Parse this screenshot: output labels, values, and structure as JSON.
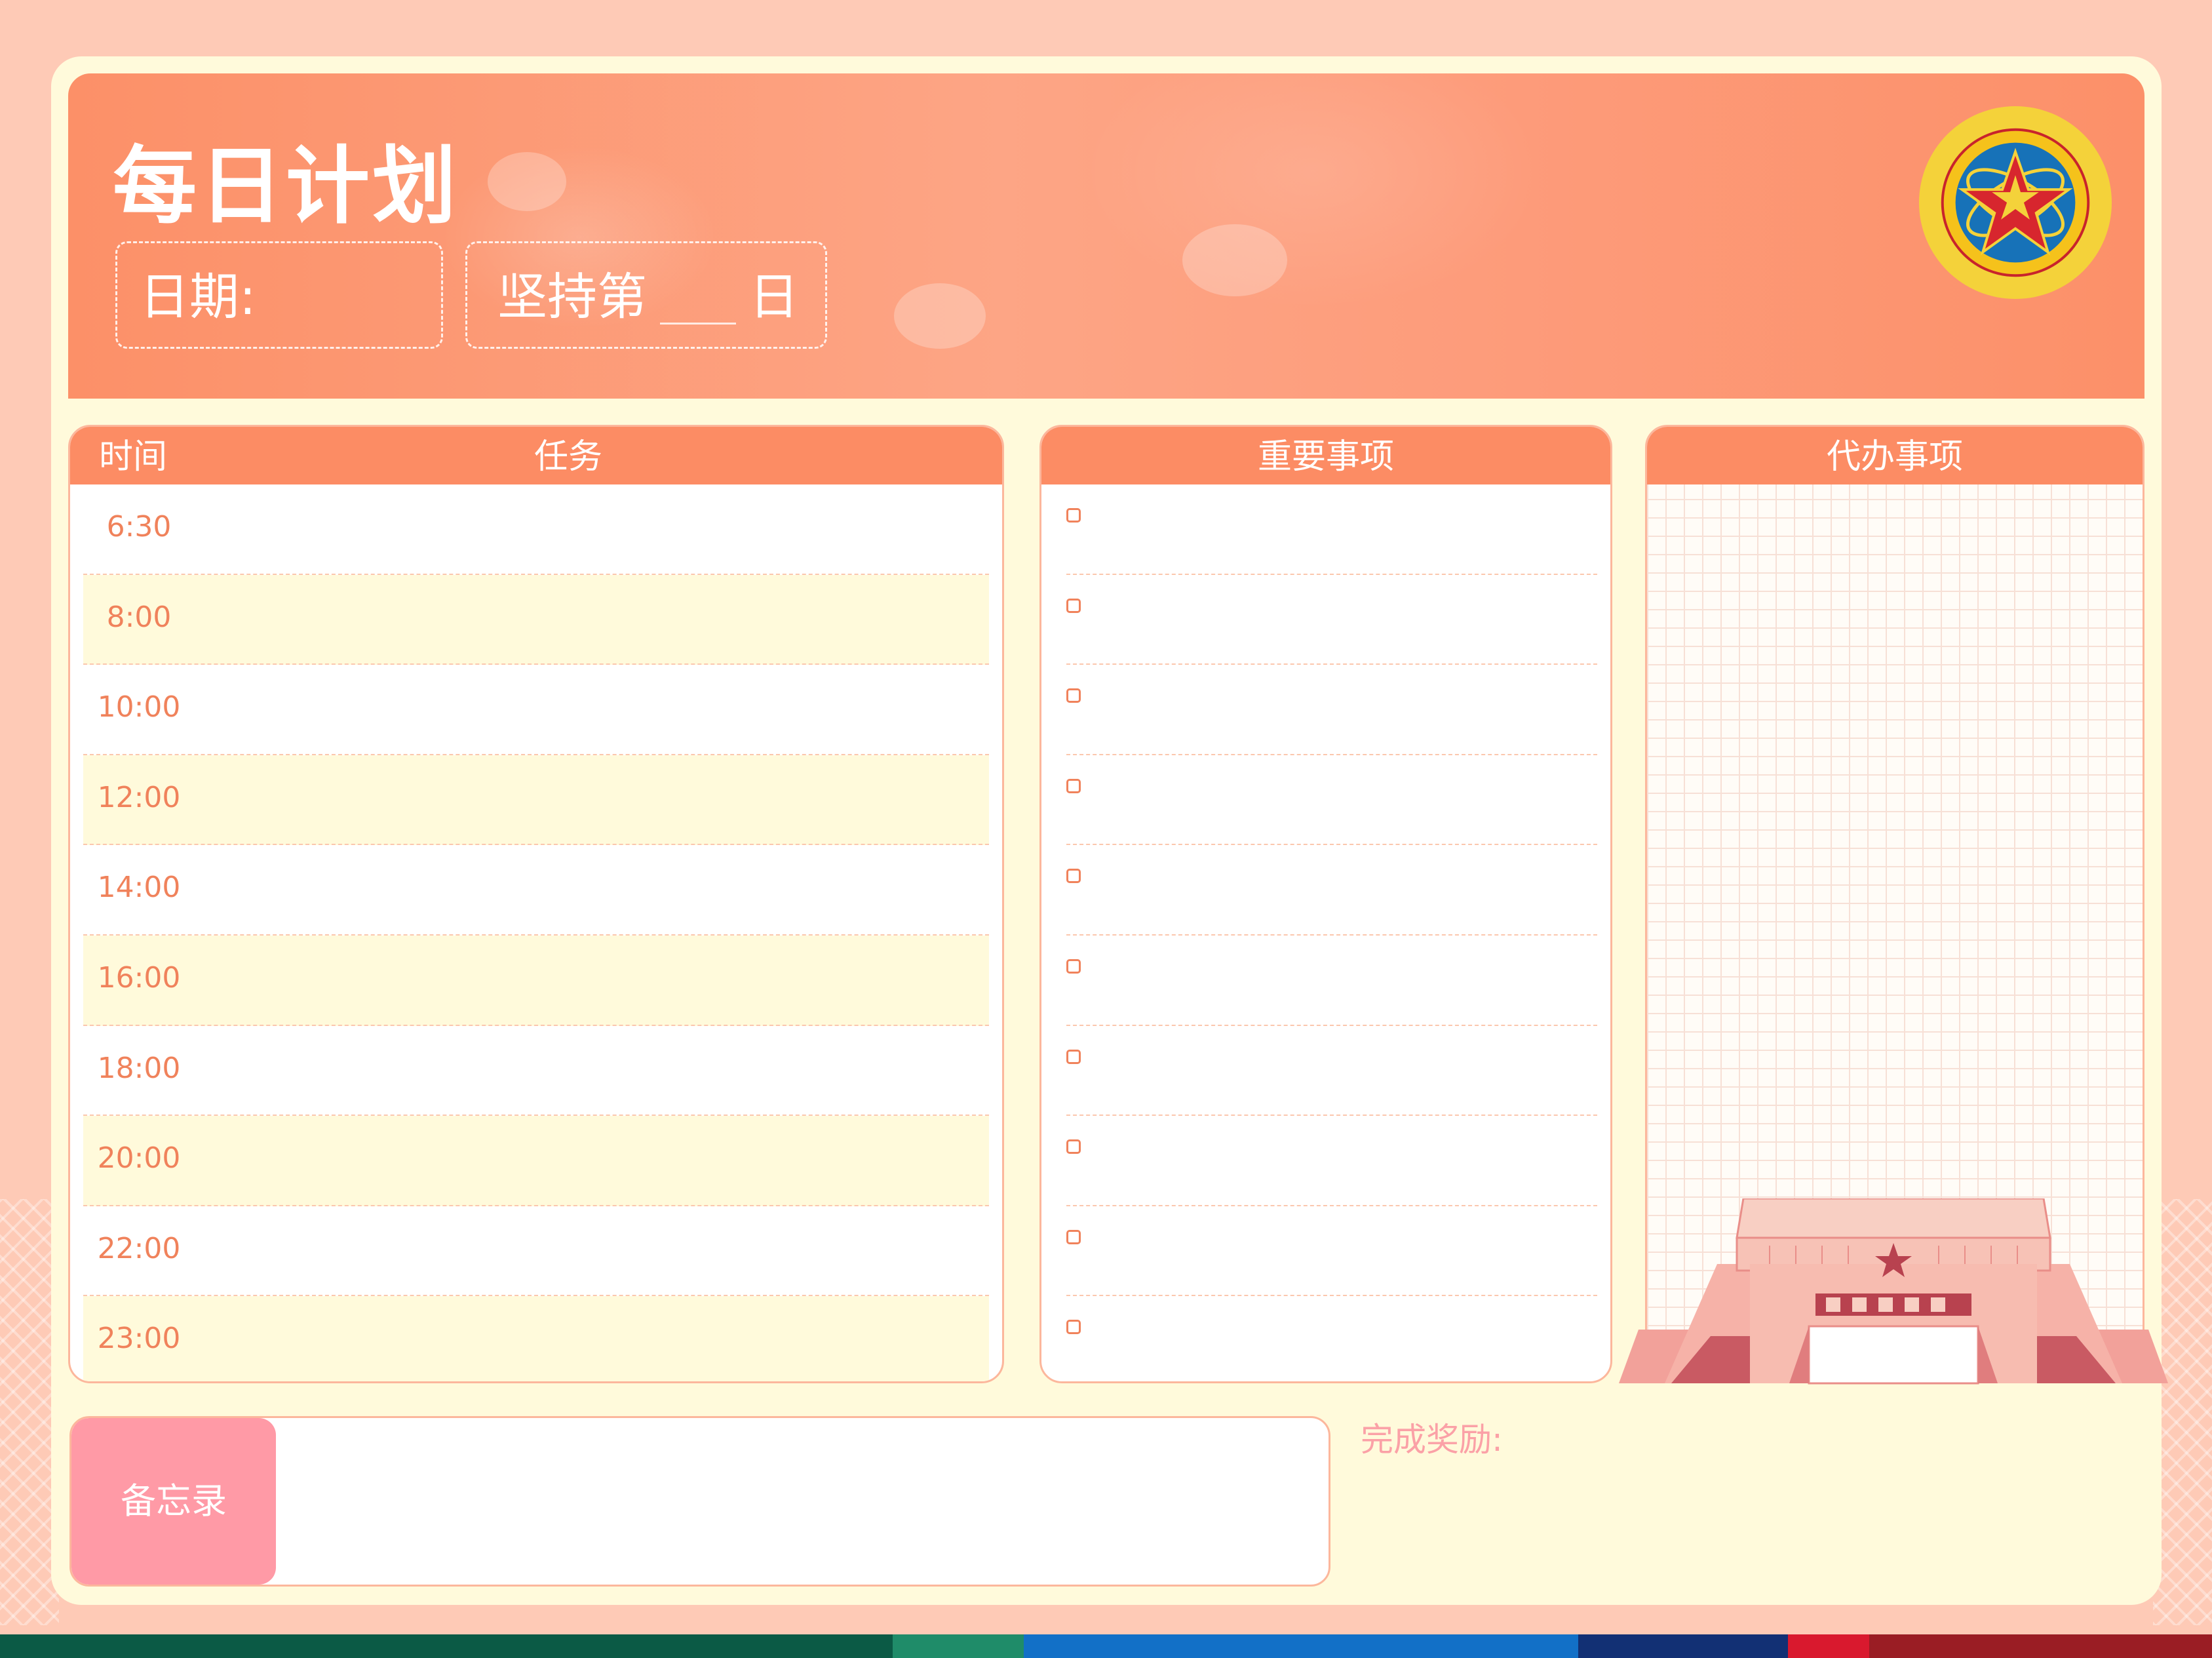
{
  "header": {
    "title": "每日计划",
    "date_label": "日期:",
    "streak_prefix": "坚持第",
    "streak_suffix": "日"
  },
  "schedule": {
    "time_header": "时间",
    "task_header": "任务",
    "times": [
      "6:30",
      "8:00",
      "10:00",
      "12:00",
      "14:00",
      "16:00",
      "18:00",
      "20:00",
      "22:00",
      "23:00"
    ]
  },
  "important": {
    "header": "重要事项",
    "item_count_label": ""
  },
  "todo": {
    "header": "代办事项"
  },
  "memo": {
    "label": "备忘录"
  },
  "reward": {
    "label": "完成奖励:"
  },
  "colors": {
    "accent": "#fc8c64",
    "background": "#fecab6",
    "card": "#fffadb",
    "memo_tab": "#ff9aa6",
    "bottom_bar": [
      "#0b5a45",
      "#1f8c69",
      "#1270c7",
      "#123074",
      "#d9192e",
      "#9a1d24"
    ]
  },
  "icons": {
    "emblem": "nudt-emblem-icon",
    "building": "university-gate-illustration",
    "checkbox": "checkbox-icon"
  }
}
